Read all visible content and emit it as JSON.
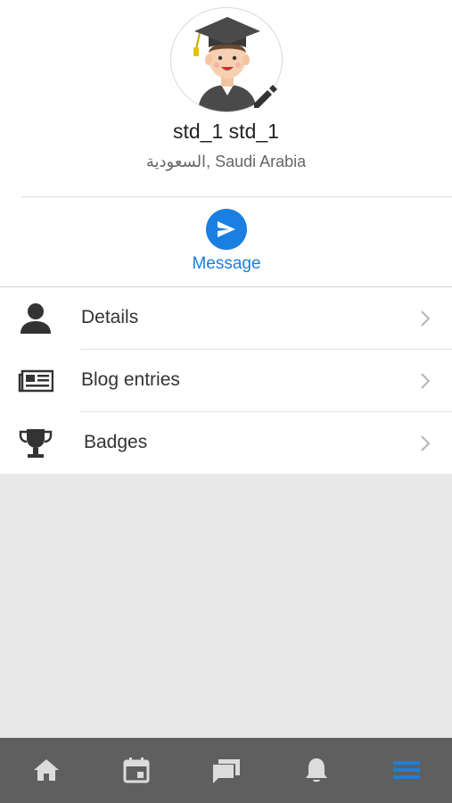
{
  "profile": {
    "name": "std_1 std_1",
    "location": "السعودية, Saudi Arabia"
  },
  "message_action": {
    "label": "Message",
    "icon": "send-icon"
  },
  "menu": {
    "items": [
      {
        "label": "Details",
        "icon": "person-icon"
      },
      {
        "label": "Blog entries",
        "icon": "newspaper-icon"
      },
      {
        "label": "Badges",
        "icon": "trophy-icon"
      }
    ]
  },
  "bottom_nav": {
    "items": [
      {
        "icon": "home-icon"
      },
      {
        "icon": "calendar-icon"
      },
      {
        "icon": "messages-icon"
      },
      {
        "icon": "bell-icon"
      },
      {
        "icon": "menu-icon",
        "active": true
      }
    ]
  },
  "colors": {
    "accent": "#1a7fe0",
    "nav_background": "#5f5f5f",
    "nav_icon": "#dcdcdc",
    "page_background": "#e8e8e8"
  }
}
